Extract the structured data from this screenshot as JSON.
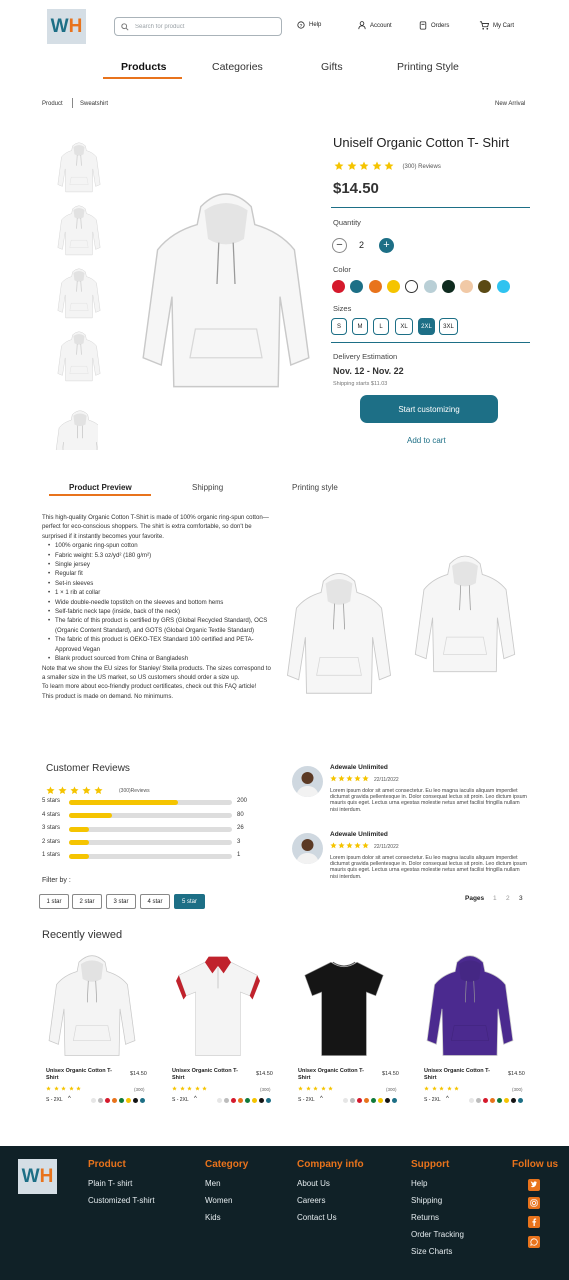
{
  "header": {
    "logo": {
      "w": "W",
      "h": "H"
    },
    "search_placeholder": "Search for product",
    "links": [
      {
        "label": "Help",
        "icon": "help-icon"
      },
      {
        "label": "Account",
        "icon": "account-icon"
      },
      {
        "label": "Orders",
        "icon": "orders-icon"
      },
      {
        "label": "My Cart",
        "icon": "cart-icon"
      }
    ]
  },
  "nav": [
    "Products",
    "Categories",
    "Gifts",
    "Printing Style"
  ],
  "breadcrumb": {
    "root": "Product",
    "current": "Sweatshirt",
    "badge": "New Arrival"
  },
  "product": {
    "title": "Uniself Organic Cotton T- Shirt",
    "rating": 5,
    "reviews": "(300) Reviews",
    "price": "$14.50",
    "quantity_label": "Quantity",
    "quantity": "2",
    "color_label": "Color",
    "colors": [
      "#d5192c",
      "#1d6f86",
      "#e8731c",
      "#f5c400",
      "#ffffff",
      "#b9cfd6",
      "#0f2b1f",
      "#f1c9a6",
      "#5b4a14",
      "#2fc3f0"
    ],
    "sizes_label": "Sizes",
    "sizes": [
      "S",
      "M",
      "L",
      "XL",
      "2XL",
      "3XL"
    ],
    "selected_size": "2XL",
    "delivery_label": "Delivery Estimation",
    "delivery_dates": "Nov. 12 - Nov. 22",
    "shipping_note": "Shipping starts $11.03",
    "cta": "Start customizing",
    "add_to_cart": "Add to cart"
  },
  "tabs": [
    "Product Preview",
    "Shipping",
    "Printing style"
  ],
  "description": {
    "intro": "This high-quality Organic Cotton T-Shirt is made of 100% organic ring-spun cotton—perfect for eco-conscious shoppers. The shirt is extra comfortable, so don't be surprised if it instantly becomes your favorite.",
    "bullets": [
      "100% organic ring-spun cotton",
      "Fabric weight: 5.3 oz/yd² (180 g/m²)",
      "Single jersey",
      "Regular fit",
      "Set-in sleeves",
      "1 × 1 rib at collar",
      "Wide double-needle topstitch on the sleeves and bottom hems",
      "Self-fabric neck tape (inside, back of the neck)",
      "The fabric of this product is certified by GRS (Global Recycled Standard), OCS (Organic Content Standard), and GOTS (Global Organic Textile Standard)",
      "The fabric of this product is OEKO-TEX Standard 100 certified and PETA-Approved Vegan",
      "Blank product sourced from China or Bangladesh"
    ],
    "note": "Note that we show the EU sizes for Stanley/ Stella products. The sizes correspond to a smaller size in the US market, so US customers should order a size up.",
    "certs": "To learn more about eco-friendly product certificates, check out this FAQ article!",
    "demand": "This product is made on demand. No minimums."
  },
  "reviews": {
    "title": "Customer Reviews",
    "count_label": "(300)Reviews",
    "breakdown": [
      {
        "label": "5 stars",
        "count": "200",
        "value": 200
      },
      {
        "label": "4 stars",
        "count": "80",
        "value": 80
      },
      {
        "label": "3 stars",
        "count": "26",
        "value": 26
      },
      {
        "label": "2 stars",
        "count": "3",
        "value": 3
      },
      {
        "label": "1 stars",
        "count": "1",
        "value": 1
      }
    ],
    "max": 300,
    "filter_label": "Filter by :",
    "filters": [
      "1 star",
      "2 star",
      "3 star",
      "4 star",
      "5 star"
    ],
    "active_filter": "5 star",
    "items": [
      {
        "name": "Adewale Unlimited",
        "date": "22/11/2022",
        "text": "Lorem ipsum dolor sit amet consectetur. Eu leo magna iaculis aliquam imperdiet dictumst gravida pellentesque in. Dolor consequat lectus sit proin. Leo dictum ipsum mauris quis eget. Lectus urna egestas molestie netus amet facilisi fringilla nullam nisi interdum."
      },
      {
        "name": "Adewale Unlimited",
        "date": "22/11/2022",
        "text": "Lorem ipsum dolor sit amet consectetur. Eu leo magna iaculis aliquam imperdiet dictumst gravida pellentesque in. Dolor consequat lectus sit proin. Leo dictum ipsum mauris quis eget. Lectus urna egestas molestie netus amet facilisi fringilla nullam nisi interdum."
      }
    ],
    "pages_label": "Pages",
    "pages": [
      "1",
      "2",
      "3"
    ]
  },
  "recent": {
    "title": "Recently viewed",
    "items": [
      {
        "name": "Unisex Organic Cotton T- Shirt",
        "price": "$14.50",
        "count": "(300)",
        "sizes": "S - 2XL",
        "garment": "hoodie",
        "color": "#f4f4f4"
      },
      {
        "name": "Unisex Organic Cotton T- Shirt",
        "price": "$14.50",
        "count": "(300)",
        "sizes": "S - 2XL",
        "garment": "polo",
        "color": "#f4f4f4"
      },
      {
        "name": "Unisex Organic Cotton T- Shirt",
        "price": "$14.50",
        "count": "(300)",
        "sizes": "S - 2XL",
        "garment": "tee",
        "color": "#151515"
      },
      {
        "name": "Unisex Organic Cotton T- Shirt",
        "price": "$14.50",
        "count": "(300)",
        "sizes": "S - 2XL",
        "garment": "hoodie",
        "color": "#4b2a8f"
      }
    ],
    "dot_colors": [
      "#e6e6e6",
      "#bcbcbc",
      "#d5192c",
      "#e8731c",
      "#0f7a3a",
      "#f5c400",
      "#151515",
      "#1d6f86"
    ]
  },
  "footer": {
    "columns": [
      {
        "title": "Product",
        "items": [
          "Plain T- shirt",
          "Customized T-shirt"
        ]
      },
      {
        "title": "Category",
        "items": [
          "Men",
          "Women",
          "Kids"
        ]
      },
      {
        "title": "Company info",
        "items": [
          "About Us",
          "Careers",
          "Contact Us"
        ]
      },
      {
        "title": "Support",
        "items": [
          "Help",
          "Shipping",
          "Returns",
          "Order Tracking",
          "Size Charts"
        ]
      }
    ],
    "follow_title": "Follow us",
    "social": [
      "twitter-icon",
      "instagram-icon",
      "facebook-icon",
      "whatsapp-icon"
    ]
  }
}
